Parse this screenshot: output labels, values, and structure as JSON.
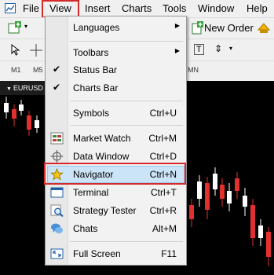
{
  "menubar": {
    "items": [
      "File",
      "View",
      "Insert",
      "Charts",
      "Tools",
      "Window",
      "Help"
    ]
  },
  "toolbar": {
    "new_order_label": "New Order",
    "timeframes": [
      "M1",
      "M5",
      "MN"
    ]
  },
  "chart": {
    "tab_label": "EURUSD"
  },
  "dropdown": {
    "items": [
      {
        "label": "Languages",
        "shortcut": "",
        "submenu": true
      },
      {
        "label": "Toolbars",
        "shortcut": "",
        "submenu": true
      },
      {
        "label": "Status Bar",
        "shortcut": "",
        "checked": true
      },
      {
        "label": "Charts Bar",
        "shortcut": "",
        "checked": true
      },
      {
        "label": "Symbols",
        "shortcut": "Ctrl+U"
      },
      {
        "label": "Market Watch",
        "shortcut": "Ctrl+M",
        "icon": "market-watch-icon"
      },
      {
        "label": "Data Window",
        "shortcut": "Ctrl+D",
        "icon": "crosshair-icon"
      },
      {
        "label": "Navigator",
        "shortcut": "Ctrl+N",
        "icon": "navigator-star-icon",
        "highlighted": true
      },
      {
        "label": "Terminal",
        "shortcut": "Ctrl+T",
        "icon": "terminal-icon"
      },
      {
        "label": "Strategy Tester",
        "shortcut": "Ctrl+R",
        "icon": "magnifier-icon"
      },
      {
        "label": "Chats",
        "shortcut": "Alt+M",
        "icon": "chat-bubbles-icon"
      },
      {
        "label": "Full Screen",
        "shortcut": "F11",
        "icon": "fullscreen-icon"
      }
    ]
  },
  "colors": {
    "highlight_red": "#d42a2a",
    "selection_blue": "#cce4f7",
    "bull_candle": "#ffffff",
    "bear_candle": "#e0312f"
  }
}
